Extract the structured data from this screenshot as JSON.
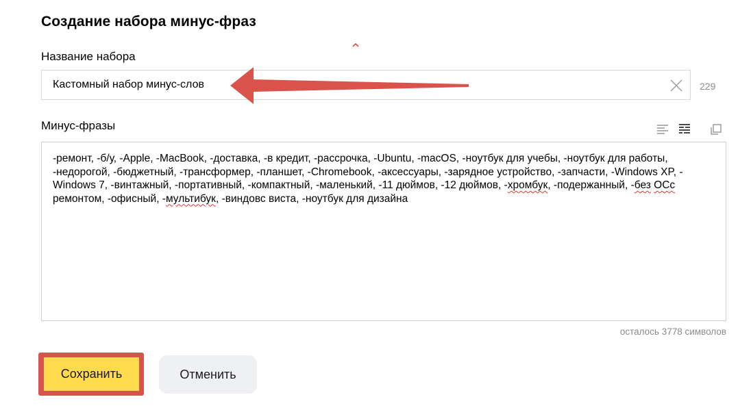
{
  "dialog": {
    "title": "Создание набора минус-фраз"
  },
  "name_field": {
    "label": "Название набора",
    "value": "Кастомный набор минус-слов",
    "counter": "229"
  },
  "phrases": {
    "label": "Минус-фразы",
    "tools": [
      "align-left-icon",
      "format-list-icon",
      "copy-icon"
    ],
    "segments": [
      {
        "text": "-ремонт, -б/у, -Apple, -MacBook, -доставка, -в кредит, -рассрочка, -Ubuntu, -macOS, -ноутбук для учебы, -ноутбук для работы, -недорогой, -бюджетный, -трансформер, -планшет, -Chromebook, -аксессуары, -зарядное устройство, -запчасти, -Windows XP, -Windows 7, -винтажный, -портативный, -компактный, -маленький, -11 дюймов, -12 дюймов, -",
        "spell": false
      },
      {
        "text": "хромбук",
        "spell": true
      },
      {
        "text": ", -подержанный, -",
        "spell": false
      },
      {
        "text": "без",
        "spell": true
      },
      {
        "text": " ",
        "spell": false
      },
      {
        "text": "ОСс",
        "spell": true
      },
      {
        "text": " ремонтом, -офисный, -",
        "spell": false
      },
      {
        "text": "мультибук",
        "spell": true
      },
      {
        "text": ", -виндовс виста, -ноутбук для дизайна",
        "spell": false
      }
    ],
    "remaining": "осталось 3778 символов"
  },
  "buttons": {
    "save": "Сохранить",
    "cancel": "Отменить"
  },
  "colors": {
    "accent_yellow": "#ffdb4d",
    "annotation_red": "#d9534a",
    "spell_underline": "#e0352b"
  }
}
